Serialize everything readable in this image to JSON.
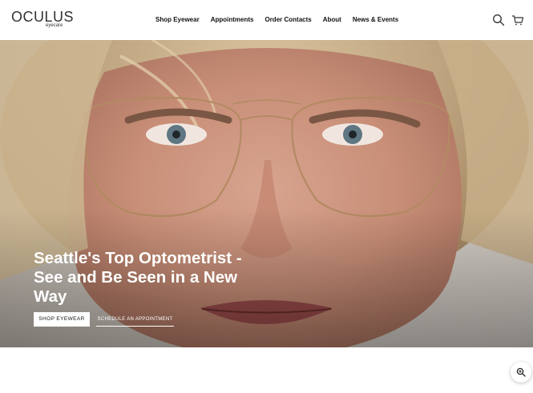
{
  "brand": {
    "name": "OCULUS",
    "sub": "eyecare"
  },
  "nav": {
    "items": [
      {
        "label": "Shop Eyewear"
      },
      {
        "label": "Appointments"
      },
      {
        "label": "Order Contacts"
      },
      {
        "label": "About"
      },
      {
        "label": "News & Events"
      }
    ]
  },
  "header_icons": {
    "search": "search-icon",
    "cart": "cart-icon"
  },
  "hero": {
    "title": "Seattle's Top Optometrist - See and Be Seen in a New Way",
    "primary_button": "SHOP EYEWEAR",
    "secondary_button": "SCHEDULE AN APPOINTMENT"
  },
  "floating_button": {
    "icon": "zoom-icon"
  },
  "colors": {
    "text": "#111111",
    "hero_text": "#ffffff"
  }
}
